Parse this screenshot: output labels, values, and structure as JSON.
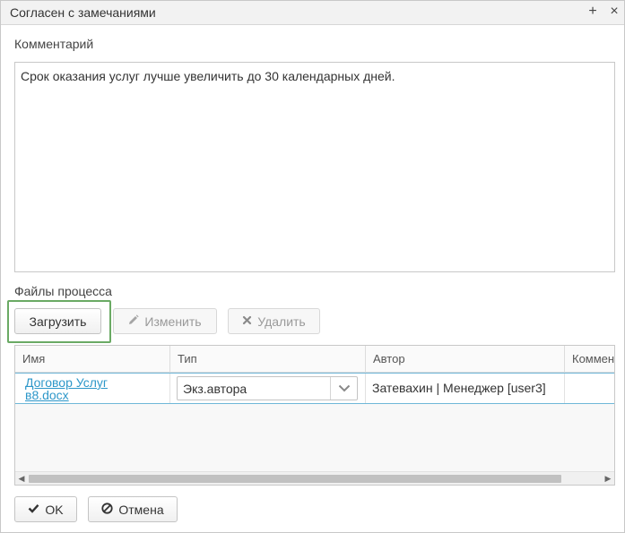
{
  "dialog": {
    "title": "Согласен с замечаниями",
    "maximize_label": "+",
    "close_label": "×"
  },
  "comment": {
    "label": "Комментарий",
    "value": "Срок оказания услуг лучше увеличить до 30 календарных дней."
  },
  "files": {
    "label": "Файлы процесса",
    "upload_label": "Загрузить",
    "edit_label": "Изменить",
    "delete_label": "Удалить",
    "columns": [
      "Имя",
      "Тип",
      "Автор",
      "Коммен"
    ],
    "rows": [
      {
        "name_line1": "Договор Услуг",
        "name_line2": "в8.docx",
        "type": "Экз.автора",
        "author": "Затевахин | Менеджер [user3]",
        "comment": ""
      }
    ]
  },
  "footer": {
    "ok_label": "OK",
    "cancel_label": "Отмена"
  },
  "colors": {
    "link": "#2d97c9",
    "highlight": "#6aaa64",
    "row_border": "#6fb7d8"
  },
  "icons": {
    "ok": "check-icon",
    "cancel": "no-entry-icon",
    "edit": "pencil-icon",
    "delete": "cross-icon",
    "select": "chevron-down-icon"
  }
}
